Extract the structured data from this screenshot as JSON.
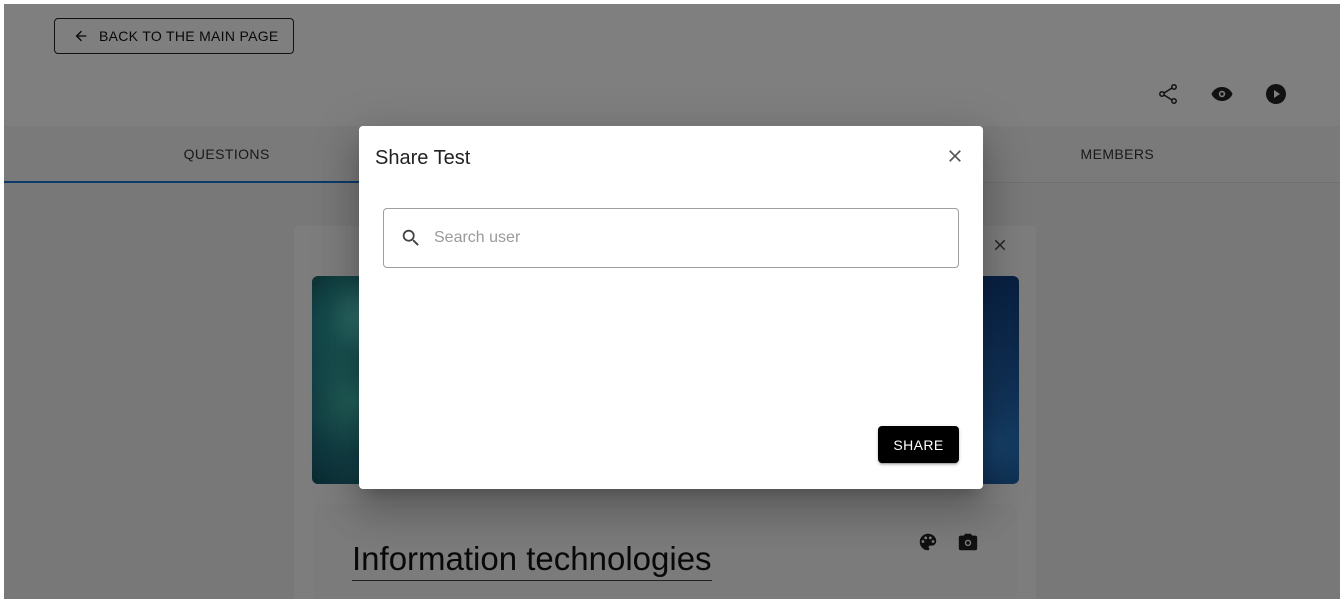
{
  "header": {
    "back_button_label": "BACK TO THE MAIN PAGE",
    "icons": [
      "share-icon",
      "eye-icon",
      "play-icon"
    ]
  },
  "tabs": [
    {
      "label": "QUESTIONS",
      "active": true
    },
    {
      "label": "",
      "active": false
    },
    {
      "label": "MEMBERS",
      "active": false
    }
  ],
  "test_card": {
    "title": "Information technologies",
    "icons": [
      "palette-icon",
      "camera-icon",
      "close-icon"
    ]
  },
  "dialog": {
    "title": "Share Test",
    "search_placeholder": "Search user",
    "search_value": "",
    "share_button_label": "SHARE"
  },
  "colors": {
    "backdrop": "rgba(0,0,0,0.5)",
    "active_tab_indicator": "#1976d2",
    "share_button": "#000000"
  }
}
